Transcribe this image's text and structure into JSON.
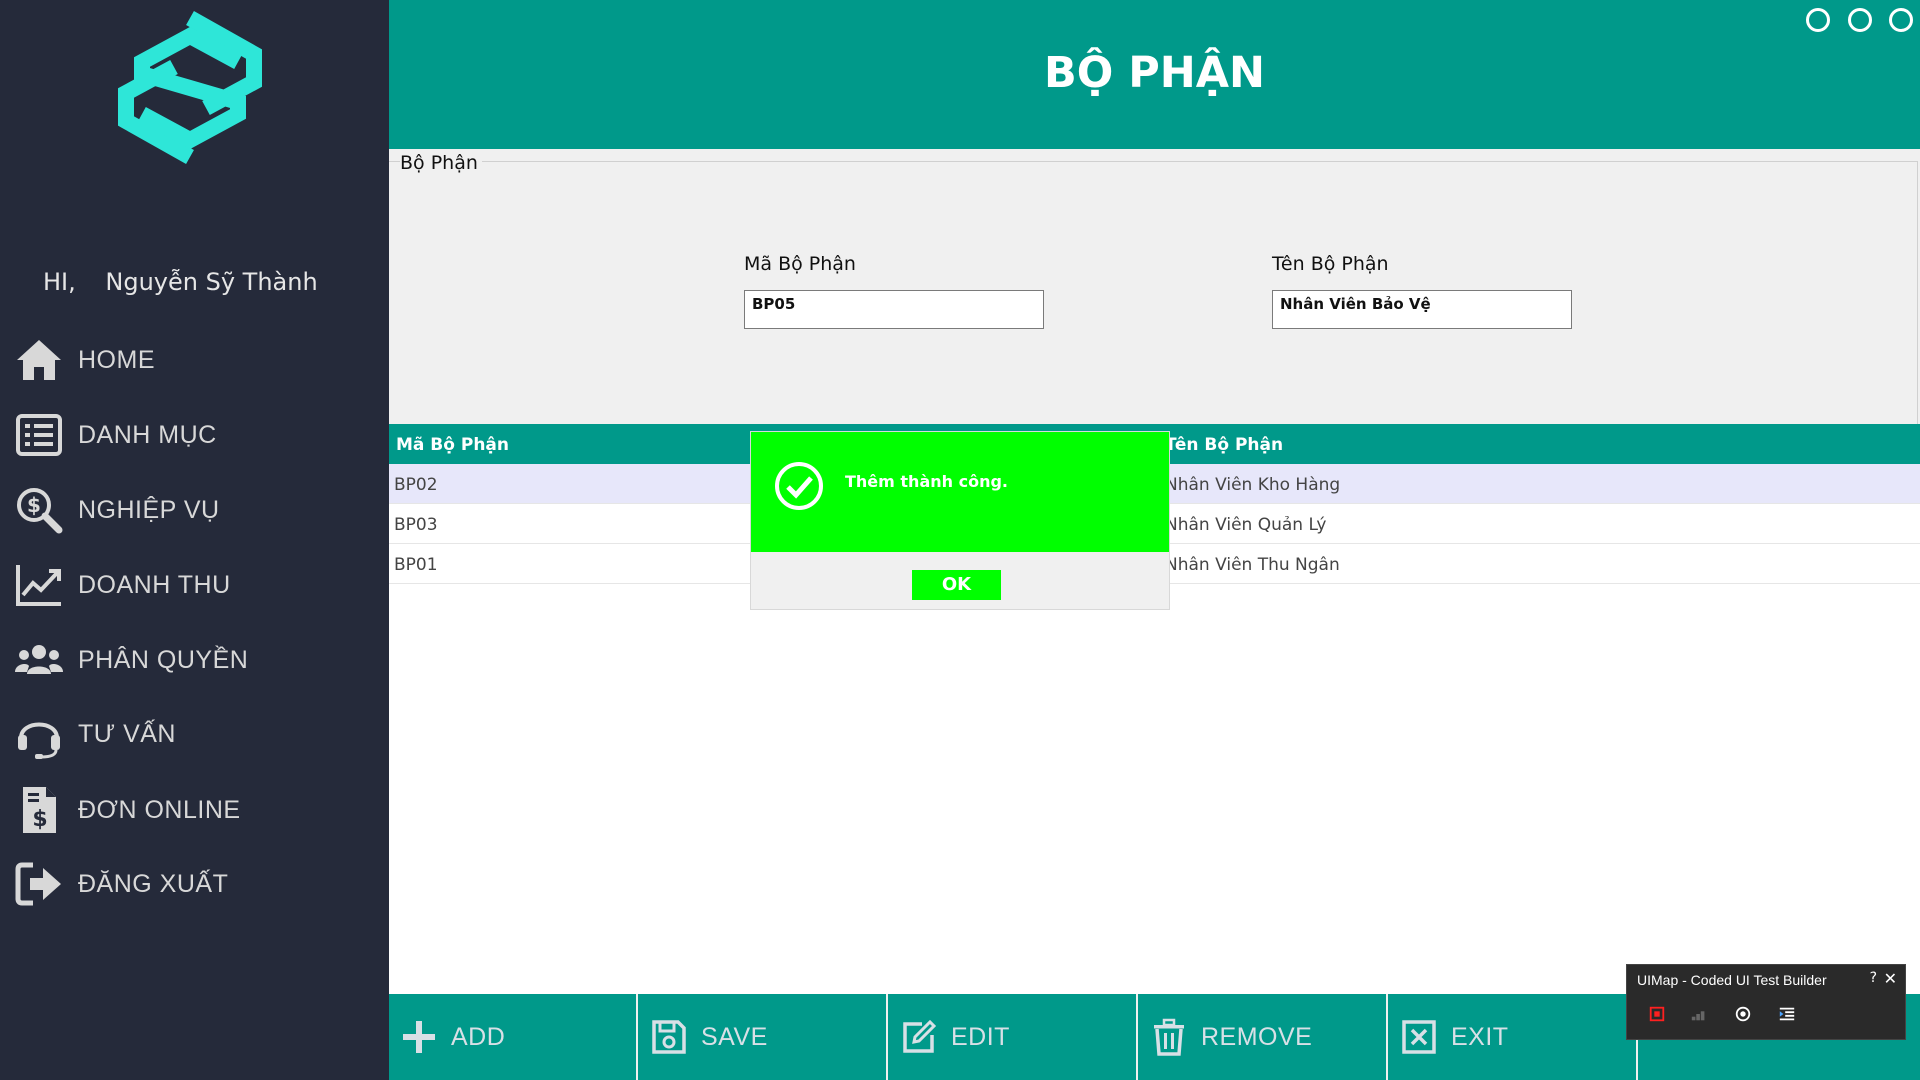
{
  "sidebar": {
    "greeting_hi": "HI,",
    "user_name": "Nguyễn Sỹ Thành",
    "items": [
      {
        "label": "HOME",
        "icon": "home-icon"
      },
      {
        "label": "DANH MỤC",
        "icon": "list-icon"
      },
      {
        "label": "NGHIỆP VỤ",
        "icon": "search-dollar-icon"
      },
      {
        "label": "DOANH THU",
        "icon": "chart-line-icon"
      },
      {
        "label": "PHÂN QUYỀN",
        "icon": "users-icon"
      },
      {
        "label": "TƯ VẤN",
        "icon": "headset-icon"
      },
      {
        "label": "ĐƠN ONLINE",
        "icon": "invoice-dollar-icon"
      },
      {
        "label": "ĐĂNG XUẤT",
        "icon": "sign-out-icon"
      }
    ]
  },
  "header": {
    "title": "BỘ PHẬN"
  },
  "form": {
    "group_title": "Bộ Phận",
    "code_label": "Mã Bộ Phận",
    "code_value": "BP05",
    "name_label": "Tên Bộ Phận",
    "name_value": "Nhân Viên Bảo Vệ"
  },
  "grid": {
    "columns": [
      "Mã Bộ Phận",
      "Tên Bộ Phận"
    ],
    "rows": [
      {
        "code": "BP02",
        "name": "Nhân Viên Kho Hàng"
      },
      {
        "code": "BP03",
        "name": "Nhân Viên Quản Lý"
      },
      {
        "code": "BP01",
        "name": "Nhân Viên Thu Ngân"
      }
    ]
  },
  "toolbar": {
    "add_label": "ADD",
    "save_label": "SAVE",
    "edit_label": "EDIT",
    "remove_label": "REMOVE",
    "exit_label": "EXIT"
  },
  "message_box": {
    "text": "Thêm thành công.",
    "ok_label": "OK",
    "color": "#00ff00"
  },
  "uimap": {
    "title": "UIMap - Coded UI Test Builder",
    "help": "?",
    "close": "✕"
  },
  "colors": {
    "sidebar_bg": "#252a3a",
    "accent_teal": "#00998a",
    "logo_cyan": "#2ee6d8"
  }
}
